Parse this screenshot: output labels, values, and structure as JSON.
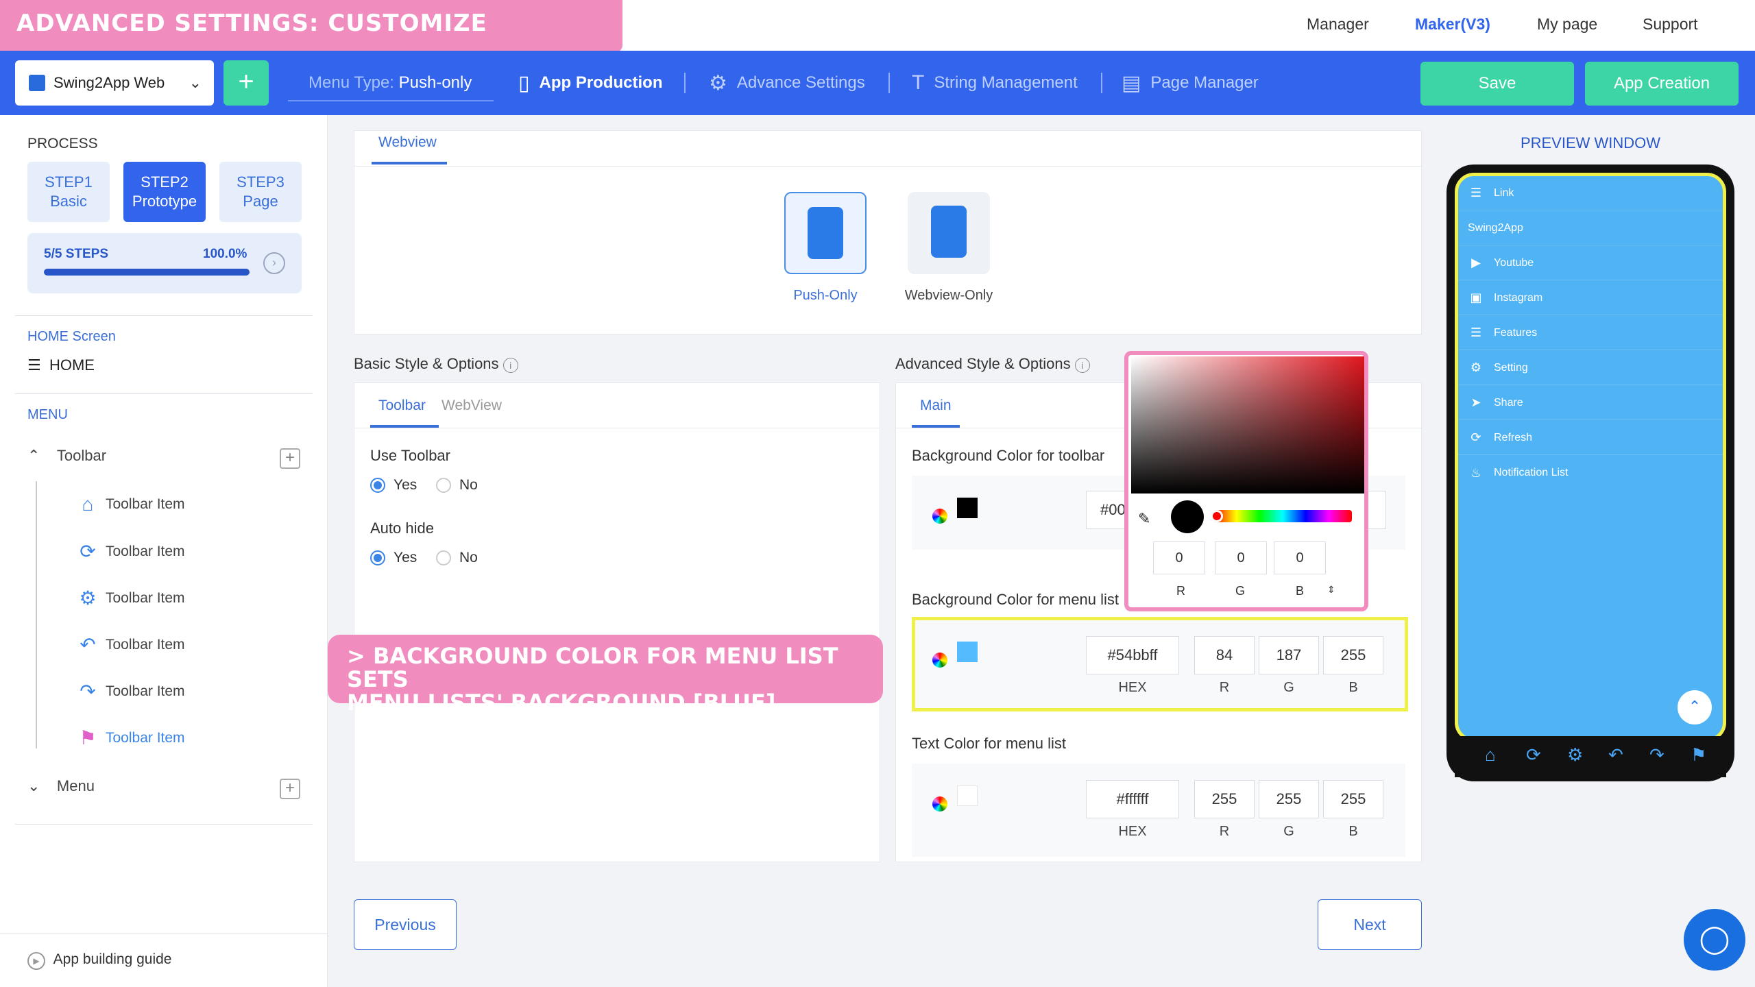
{
  "banner": "ADVANCED SETTINGS: CUSTOMIZE TOOLBAR COLOR",
  "topnav": {
    "manager": "Manager",
    "maker": "Maker(V3)",
    "mypage": "My page",
    "support": "Support"
  },
  "app_select": "Swing2App Web",
  "menu_type": {
    "label": "Menu Type:",
    "value": "Push-only"
  },
  "nav": {
    "app_production": "App Production",
    "advance_settings": "Advance Settings",
    "string_management": "String Management",
    "page_manager": "Page Manager"
  },
  "buttons": {
    "save": "Save",
    "app_creation": "App Creation",
    "previous": "Previous",
    "next": "Next"
  },
  "sidebar": {
    "process": "PROCESS",
    "steps": [
      {
        "l1": "STEP1",
        "l2": "Basic"
      },
      {
        "l1": "STEP2",
        "l2": "Prototype"
      },
      {
        "l1": "STEP3",
        "l2": "Page"
      }
    ],
    "progress_label": "5/5 STEPS",
    "progress_pct": "100.0%",
    "progress_fraction": 1.0,
    "home_screen": "HOME Screen",
    "home": "HOME",
    "menu_heading": "MENU",
    "toolbar": "Toolbar",
    "toolbar_items": [
      "Toolbar Item",
      "Toolbar Item",
      "Toolbar Item",
      "Toolbar Item",
      "Toolbar Item",
      "Toolbar Item"
    ],
    "menu": "Menu",
    "guide": "App building guide"
  },
  "webview_panel": {
    "tab": "Webview",
    "options": [
      "Push-Only",
      "Webview-Only"
    ]
  },
  "basic": {
    "title": "Basic Style & Options",
    "tabs": [
      "Toolbar",
      "WebView"
    ],
    "use_toolbar": "Use Toolbar",
    "auto_hide": "Auto hide",
    "yes": "Yes",
    "no": "No"
  },
  "advanced": {
    "title": "Advanced Style & Options",
    "tab": "Main",
    "bg_toolbar": "Background Color for toolbar",
    "bg_toolbar_hex": "#00",
    "bg_menu": "Background Color for menu list",
    "bg_menu_hex": "#54bbff",
    "bg_menu_r": "84",
    "bg_menu_g": "187",
    "bg_menu_b": "255",
    "text_menu": "Text Color for menu list",
    "text_hex": "#ffffff",
    "text_r": "255",
    "text_g": "255",
    "text_b": "255",
    "caps": {
      "hex": "HEX",
      "r": "R",
      "g": "G",
      "b": "B"
    }
  },
  "picker": {
    "r": "0",
    "g": "0",
    "b": "0"
  },
  "overlay": [
    "> BACKGROUND COLOR FOR MENU LIST SETS",
    "MENU LISTS' BACKGROUND [BLUE]"
  ],
  "preview": {
    "title": "PREVIEW WINDOW",
    "items": [
      "Link",
      "Swing2App",
      "Youtube",
      "Instagram",
      "Features",
      "Setting",
      "Share",
      "Refresh",
      "Notification List"
    ]
  },
  "colors": {
    "primary": "#3265eb",
    "accent": "#3dd4a6",
    "pink": "#f08dbe",
    "menu_bg": "#54bbff"
  }
}
